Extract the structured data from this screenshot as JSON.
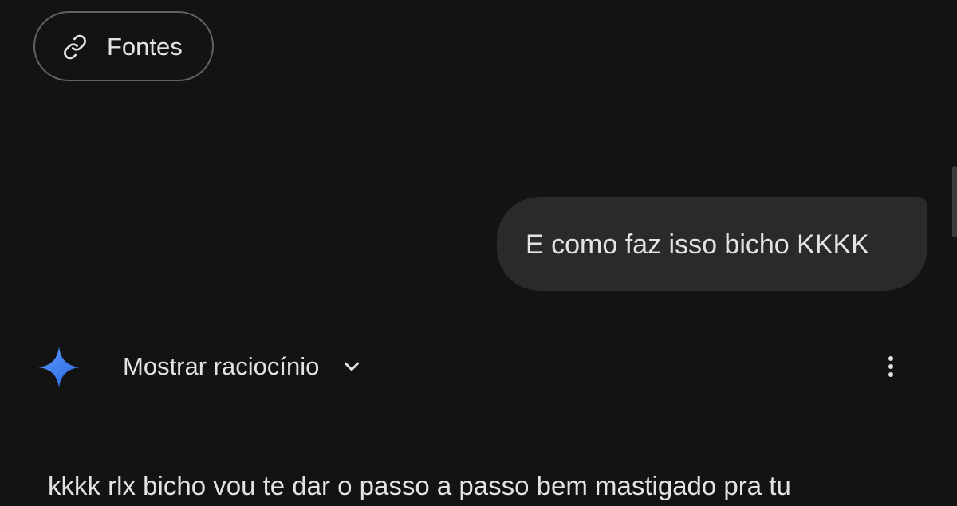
{
  "sources_chip": {
    "label": "Fontes",
    "icon": "link-icon"
  },
  "user_message": {
    "text": "E como faz isso bicho KKKK"
  },
  "model_response": {
    "avatar_icon": "gemini-sparkle-icon",
    "reasoning_toggle_label": "Mostrar raciocínio",
    "reasoning_toggle_icon": "chevron-down-icon",
    "more_icon": "more-vert-icon",
    "text": "kkkk rlx bicho vou te dar o passo a passo bem mastigado pra tu"
  },
  "colors": {
    "background": "#131314",
    "user_bubble": "#2a2a2c",
    "text": "#e3e3e3",
    "chip_border": "#5f6368",
    "sparkle_gradient": [
      "#4f8ff7",
      "#2f6fe8"
    ]
  }
}
